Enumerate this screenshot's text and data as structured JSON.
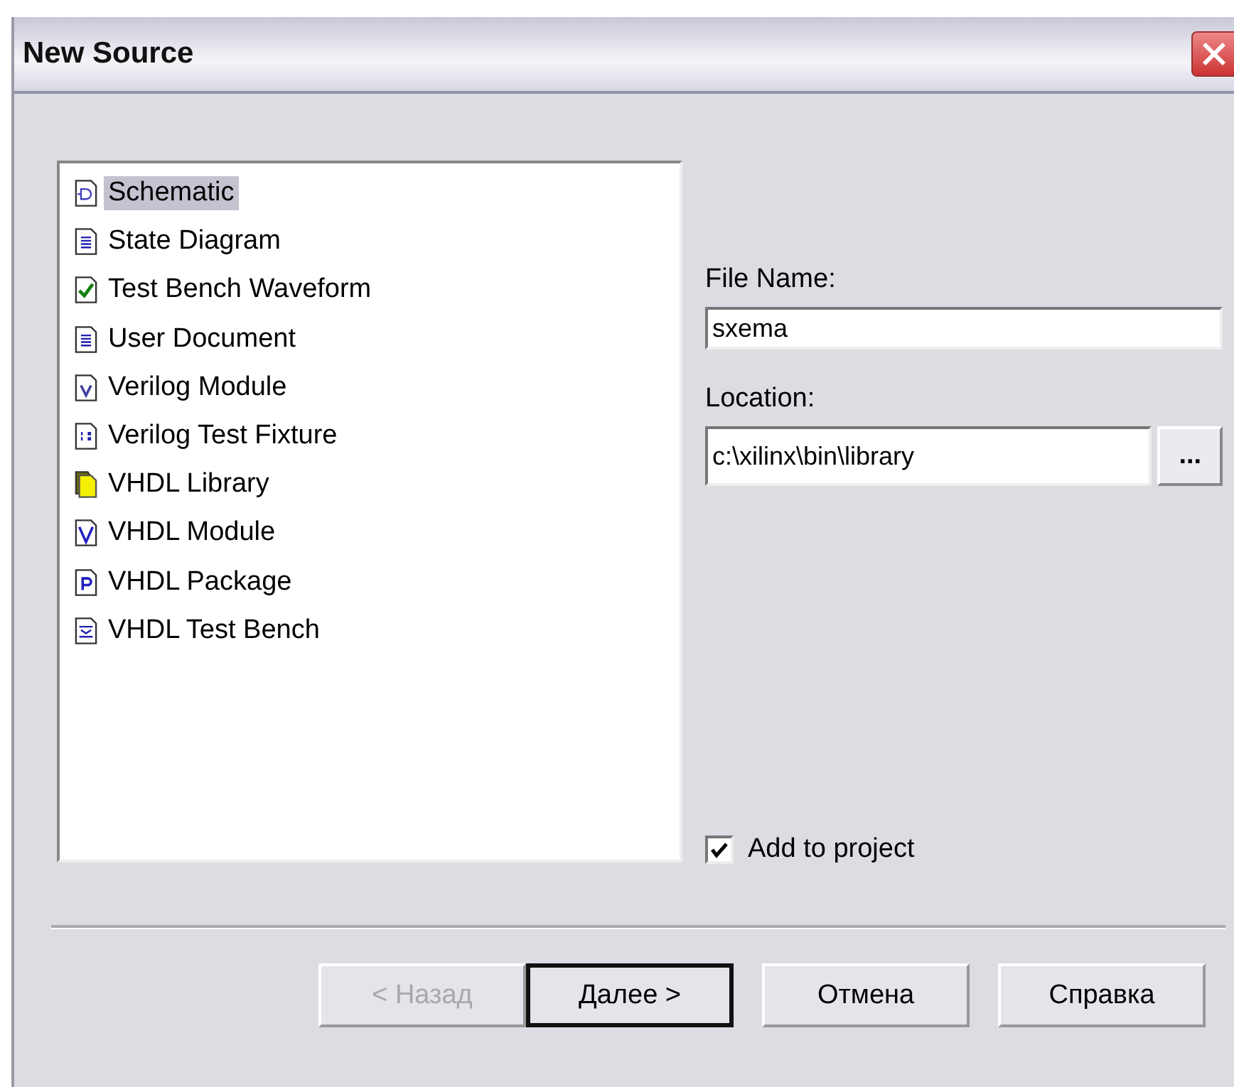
{
  "window": {
    "title": "New Source"
  },
  "source_types": [
    {
      "label": "Schematic",
      "kind": "schematic",
      "selected": true
    },
    {
      "label": "State Diagram",
      "kind": "document",
      "selected": false
    },
    {
      "label": "Test Bench Waveform",
      "kind": "waveform",
      "selected": false
    },
    {
      "label": "User Document",
      "kind": "document",
      "selected": false
    },
    {
      "label": "Verilog Module",
      "kind": "verilog",
      "selected": false
    },
    {
      "label": "Verilog Test Fixture",
      "kind": "fixture",
      "selected": false
    },
    {
      "label": "VHDL Library",
      "kind": "library",
      "selected": false
    },
    {
      "label": "VHDL Module",
      "kind": "vhdl",
      "selected": false
    },
    {
      "label": "VHDL Package",
      "kind": "package",
      "selected": false
    },
    {
      "label": "VHDL Test Bench",
      "kind": "testbench",
      "selected": false
    }
  ],
  "file_name": {
    "label": "File Name:",
    "value": "sxema"
  },
  "location": {
    "label": "Location:",
    "value": "c:\\xilinx\\bin\\library",
    "browse": "..."
  },
  "add_to_project": {
    "label": "Add to project",
    "checked": true
  },
  "buttons": [
    {
      "label": "< Назад",
      "disabled": true,
      "default": false
    },
    {
      "label": "Далее >",
      "disabled": false,
      "default": true
    },
    {
      "label": "Отмена",
      "disabled": false,
      "default": false
    },
    {
      "label": "Справка",
      "disabled": false,
      "default": false
    }
  ]
}
